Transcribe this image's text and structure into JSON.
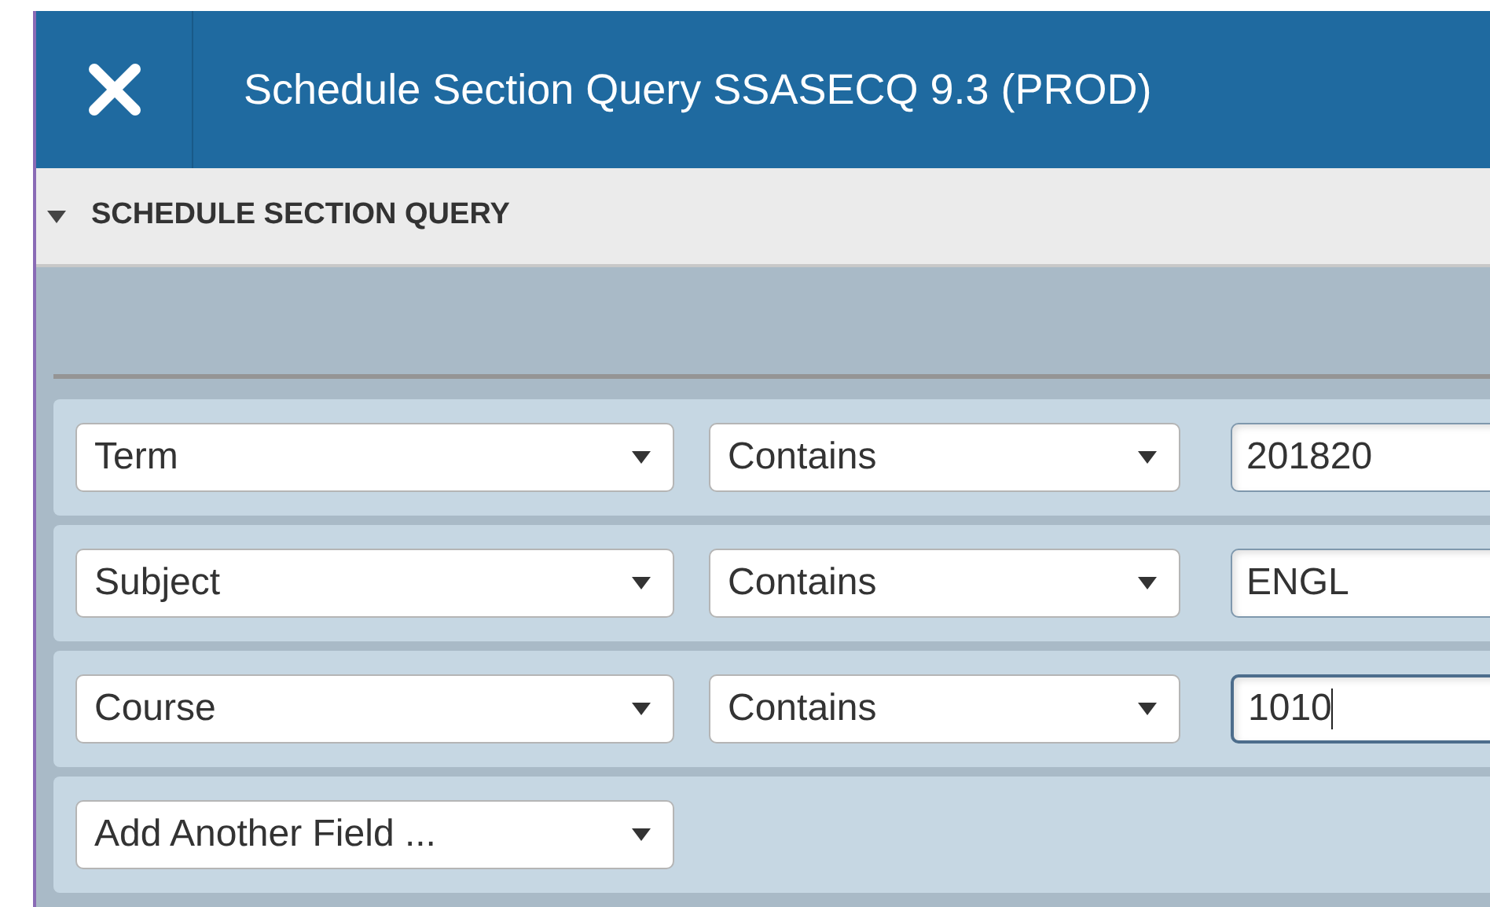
{
  "window": {
    "title": "Schedule Section Query SSASECQ 9.3 (PROD)"
  },
  "section": {
    "title": "SCHEDULE SECTION QUERY",
    "expanded": true
  },
  "criteria": [
    {
      "kind": "filter",
      "field": "Term",
      "operator": "Contains",
      "value": "201820",
      "focused": false
    },
    {
      "kind": "filter",
      "field": "Subject",
      "operator": "Contains",
      "value": "ENGL",
      "focused": false
    },
    {
      "kind": "filter",
      "field": "Course",
      "operator": "Contains",
      "value": "1010",
      "focused": true
    },
    {
      "kind": "add",
      "field": "Add Another Field ..."
    }
  ]
}
